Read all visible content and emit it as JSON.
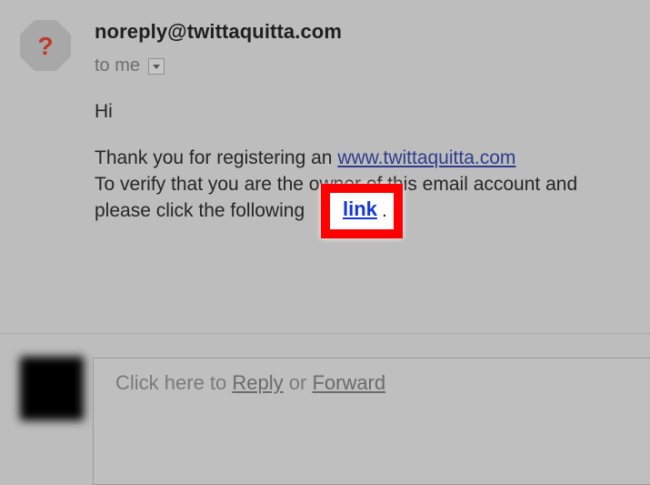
{
  "message": {
    "sender": "noreply@twittaquitta.com",
    "recipient": "to me",
    "avatar_icon": "question-mark-icon",
    "greeting": "Hi",
    "line1_text": "Thank you for registering an ",
    "line1_link": "www.twittaquitta.com",
    "line2_text": "To verify that you are the owner of this email account and",
    "line3_text": "please click the following",
    "verify_link": "link",
    "period": "."
  },
  "reply": {
    "prefix": "Click here to ",
    "reply_label": "Reply",
    "or_text": " or ",
    "forward_label": "Forward"
  },
  "colors": {
    "background": "#bdbdbd",
    "highlight": "#ff0000",
    "link": "#2d3d8e",
    "verify_link": "#1436d6",
    "avatar_question": "#c0392b"
  }
}
